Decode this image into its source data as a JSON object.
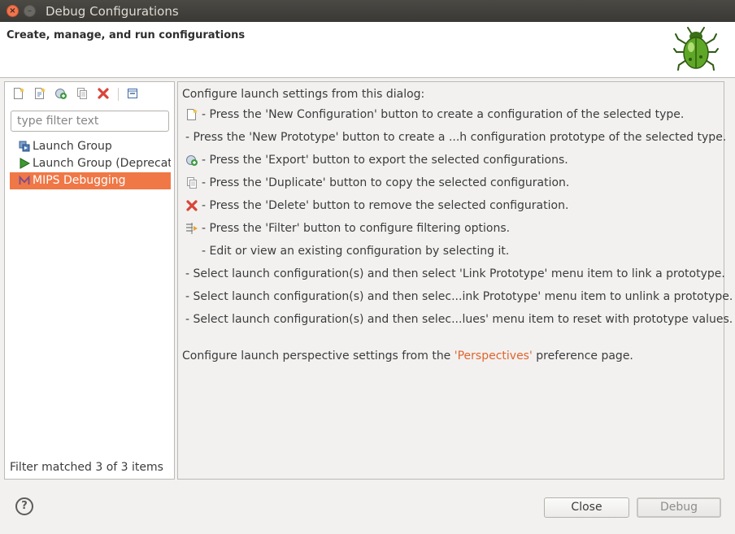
{
  "window": {
    "title": "Debug Configurations",
    "close_glyph": "×",
    "minimize_glyph": "–"
  },
  "header": {
    "heading": "Create, manage, and run configurations",
    "logo_icon": "bug-icon"
  },
  "left": {
    "toolbar": [
      {
        "name": "new-configuration-button",
        "icon": "new-configuration-icon"
      },
      {
        "name": "new-prototype-button",
        "icon": "new-prototype-icon"
      },
      {
        "name": "export-button",
        "icon": "export-icon"
      },
      {
        "name": "duplicate-button",
        "icon": "duplicate-icon"
      },
      {
        "name": "delete-button",
        "icon": "delete-icon"
      },
      {
        "name": "collapse-all-button",
        "icon": "collapse-all-icon"
      }
    ],
    "filter_placeholder": "type filter text",
    "filter_value": "",
    "tree": [
      {
        "label": "Launch Group",
        "icon": "launch-group-icon",
        "selected": false
      },
      {
        "label": "Launch Group (Deprecated)",
        "icon": "launch-group-deprecated-icon",
        "selected": false
      },
      {
        "label": "MIPS Debugging",
        "icon": "mips-icon",
        "selected": true
      }
    ],
    "status": "Filter matched 3 of 3 items"
  },
  "right": {
    "intro": "Configure launch settings from this dialog:",
    "lines": [
      {
        "icon": "new-configuration-icon",
        "text": "- Press the 'New Configuration' button to create a configuration of the selected type."
      },
      {
        "icon": "",
        "text": "- Press the 'New Prototype' button to create a ...h configuration prototype of the selected type."
      },
      {
        "icon": "export-icon",
        "text": "- Press the 'Export' button to export the selected configurations."
      },
      {
        "icon": "duplicate-icon",
        "text": "- Press the 'Duplicate' button to copy the selected configuration."
      },
      {
        "icon": "delete-icon",
        "text": "- Press the 'Delete' button to remove the selected configuration."
      },
      {
        "icon": "filter-icon",
        "text": "- Press the 'Filter' button to configure filtering options."
      },
      {
        "icon": "",
        "indent": true,
        "text": "- Edit or view an existing configuration by selecting it."
      },
      {
        "icon": "",
        "text": "- Select launch configuration(s) and then select 'Link Prototype' menu item to link a prototype."
      },
      {
        "icon": "",
        "text": "- Select launch configuration(s) and then selec...ink Prototype' menu item to unlink a prototype."
      },
      {
        "icon": "",
        "text": "- Select launch configuration(s) and then selec...lues' menu item to reset with prototype values."
      }
    ],
    "perspective_prefix": "Configure launch perspective settings from the ",
    "perspective_link": "'Perspectives'",
    "perspective_suffix": " preference page."
  },
  "footer": {
    "help_glyph": "?",
    "close_label": "Close",
    "debug_label": "Debug"
  },
  "colors": {
    "selection": "#f07746",
    "link": "#e0642c",
    "titlebar": "#3c3b37"
  }
}
